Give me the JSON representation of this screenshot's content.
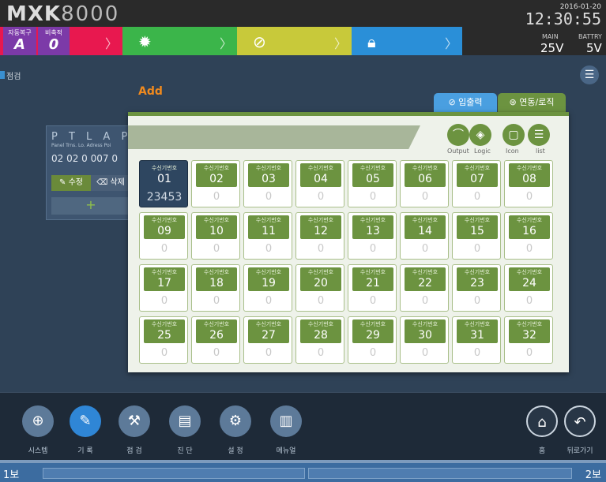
{
  "header": {
    "logo_bold": "MXK",
    "logo_thin": "8000",
    "date": "2016-01-20",
    "time": "12:30:55",
    "main_label": "MAIN",
    "main_value": "25V",
    "battery_label": "BATTRY",
    "battery_value": "5V",
    "auto_restore_label": "자동복구",
    "auto_restore_value": "A",
    "broadcast_label": "비축적",
    "broadcast_value": "0",
    "segments": [
      {
        "name": "fire",
        "icon": "fire-icon",
        "color": "#e8184f"
      },
      {
        "name": "supervisory",
        "icon": "gear-star-icon",
        "color": "#3bb54a"
      },
      {
        "name": "trouble",
        "icon": "slash-circle-icon",
        "color": "#c8c93a"
      },
      {
        "name": "security",
        "icon": "lock-icon",
        "color": "#2a8fd8"
      }
    ]
  },
  "breadcrumb": "점검",
  "background_panel": {
    "heads": "P T L A P",
    "sub_heads": "Panel Trns. Lo. Adress Poi",
    "value": "02 02 0 007 0",
    "edit_label": "수정",
    "delete_label": "삭제",
    "add_symbol": "+"
  },
  "popup": {
    "title": "Add",
    "tab_io": "입출력",
    "tab_link": "연동/로직",
    "tools": {
      "output": "Output",
      "logic": "Logic",
      "icon": "Icon",
      "list": "list"
    },
    "cell_label": "수신기번호",
    "cells": [
      {
        "num": "01",
        "val": "23453",
        "selected": true
      },
      {
        "num": "02",
        "val": "0"
      },
      {
        "num": "03",
        "val": "0"
      },
      {
        "num": "04",
        "val": "0"
      },
      {
        "num": "05",
        "val": "0"
      },
      {
        "num": "06",
        "val": "0"
      },
      {
        "num": "07",
        "val": "0"
      },
      {
        "num": "08",
        "val": "0"
      },
      {
        "num": "09",
        "val": "0"
      },
      {
        "num": "10",
        "val": "0"
      },
      {
        "num": "11",
        "val": "0"
      },
      {
        "num": "12",
        "val": "0"
      },
      {
        "num": "13",
        "val": "0"
      },
      {
        "num": "14",
        "val": "0"
      },
      {
        "num": "15",
        "val": "0"
      },
      {
        "num": "16",
        "val": "0"
      },
      {
        "num": "17",
        "val": "0"
      },
      {
        "num": "18",
        "val": "0"
      },
      {
        "num": "19",
        "val": "0"
      },
      {
        "num": "20",
        "val": "0"
      },
      {
        "num": "21",
        "val": "0"
      },
      {
        "num": "22",
        "val": "0"
      },
      {
        "num": "23",
        "val": "0"
      },
      {
        "num": "24",
        "val": "0"
      },
      {
        "num": "25",
        "val": "0"
      },
      {
        "num": "26",
        "val": "0"
      },
      {
        "num": "27",
        "val": "0"
      },
      {
        "num": "28",
        "val": "0"
      },
      {
        "num": "29",
        "val": "0"
      },
      {
        "num": "30",
        "val": "0"
      },
      {
        "num": "31",
        "val": "0"
      },
      {
        "num": "32",
        "val": "0"
      }
    ]
  },
  "nav": [
    {
      "key": "system",
      "label": "시스템",
      "icon": "globe-icon",
      "glyph": "⊕"
    },
    {
      "key": "record",
      "label": "기 록",
      "icon": "pencil-icon",
      "glyph": "✎",
      "active": true
    },
    {
      "key": "inspect",
      "label": "점 검",
      "icon": "tools-icon",
      "glyph": "⚒"
    },
    {
      "key": "diagnose",
      "label": "진 단",
      "icon": "clipboard-icon",
      "glyph": "▤"
    },
    {
      "key": "settings",
      "label": "설 정",
      "icon": "gear-icon",
      "glyph": "⚙"
    },
    {
      "key": "manual",
      "label": "메뉴얼",
      "icon": "book-icon",
      "glyph": "▥"
    }
  ],
  "nav_right": {
    "home_label": "홈",
    "home_glyph": "⌂",
    "back_label": "뒤로가기",
    "back_glyph": "↶"
  },
  "footer": {
    "left": "1보",
    "right": "2보"
  }
}
